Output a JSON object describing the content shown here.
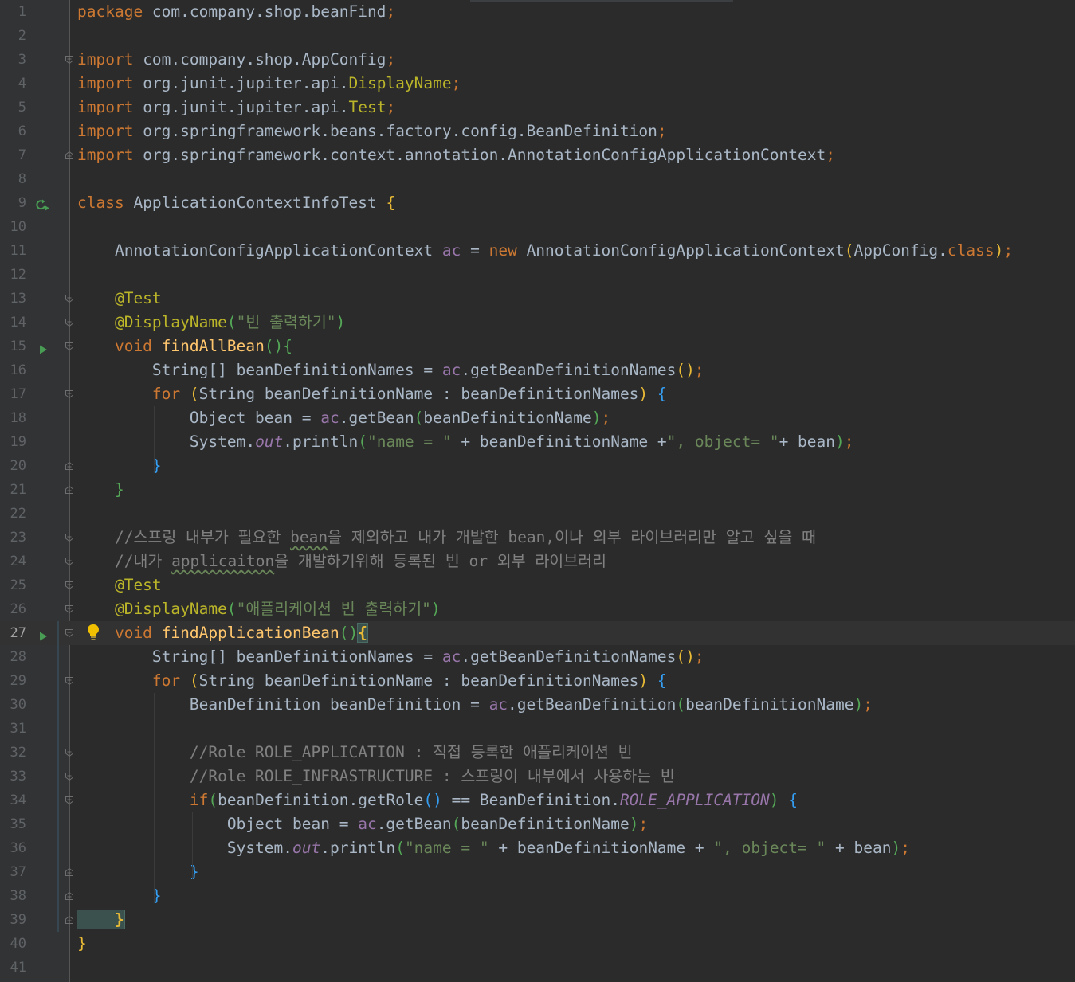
{
  "editor": {
    "current_line": 27,
    "lines": [
      {
        "n": "1",
        "s": [
          [
            "kw",
            "package "
          ],
          [
            "",
            "com.company.shop.beanFind"
          ],
          [
            "kw",
            ";"
          ]
        ]
      },
      {
        "n": "2",
        "s": []
      },
      {
        "n": "3",
        "s": [
          [
            "kw",
            "import "
          ],
          [
            "",
            "com.company.shop.AppConfig"
          ],
          [
            "kw",
            ";"
          ]
        ]
      },
      {
        "n": "4",
        "s": [
          [
            "kw",
            "import "
          ],
          [
            "",
            "org.junit.jupiter.api."
          ],
          [
            "ann",
            "DisplayName"
          ],
          [
            "kw",
            ";"
          ]
        ]
      },
      {
        "n": "5",
        "s": [
          [
            "kw",
            "import "
          ],
          [
            "",
            "org.junit.jupiter.api."
          ],
          [
            "ann",
            "Test"
          ],
          [
            "kw",
            ";"
          ]
        ]
      },
      {
        "n": "6",
        "s": [
          [
            "kw",
            "import "
          ],
          [
            "",
            "org.springframework.beans.factory.config.BeanDefinition"
          ],
          [
            "kw",
            ";"
          ]
        ]
      },
      {
        "n": "7",
        "s": [
          [
            "kw",
            "import "
          ],
          [
            "",
            "org.springframework.context.annotation.AnnotationConfigApplicationContext"
          ],
          [
            "kw",
            ";"
          ]
        ]
      },
      {
        "n": "8",
        "s": []
      },
      {
        "n": "9",
        "s": [
          [
            "kw",
            "class "
          ],
          [
            "",
            "ApplicationContextInfoTest "
          ],
          [
            "pY",
            "{"
          ]
        ]
      },
      {
        "n": "10",
        "s": []
      },
      {
        "n": "11",
        "s": [
          [
            "",
            "    AnnotationConfigApplicationContext "
          ],
          [
            "fld",
            "ac"
          ],
          [
            "",
            " = "
          ],
          [
            "kw",
            "new "
          ],
          [
            "",
            "AnnotationConfigApplicationContext"
          ],
          [
            "pY",
            "("
          ],
          [
            "",
            "AppConfig."
          ],
          [
            "kw",
            "class"
          ],
          [
            "pY",
            ")"
          ],
          [
            "kw",
            ";"
          ]
        ]
      },
      {
        "n": "12",
        "s": []
      },
      {
        "n": "13",
        "s": [
          [
            "ann",
            "    @Test"
          ]
        ]
      },
      {
        "n": "14",
        "s": [
          [
            "ann",
            "    @DisplayName"
          ],
          [
            "pG",
            "("
          ],
          [
            "str",
            "\"빈 출력하기\""
          ],
          [
            "pG",
            ")"
          ]
        ]
      },
      {
        "n": "15",
        "s": [
          [
            "kw",
            "    void "
          ],
          [
            "meth",
            "findAllBean"
          ],
          [
            "pG",
            "()"
          ],
          [
            "pG",
            "{"
          ]
        ]
      },
      {
        "n": "16",
        "s": [
          [
            "",
            "        String[] beanDefinitionNames = "
          ],
          [
            "fld",
            "ac"
          ],
          [
            "",
            "."
          ],
          [
            "",
            "getBeanDefinitionNames"
          ],
          [
            "pY",
            "()"
          ],
          [
            "kw",
            ";"
          ]
        ]
      },
      {
        "n": "17",
        "s": [
          [
            "kw",
            "        for "
          ],
          [
            "pY",
            "("
          ],
          [
            "",
            "String beanDefinitionName : beanDefinitionNames"
          ],
          [
            "pY",
            ")"
          ],
          [
            "",
            " "
          ],
          [
            "pB",
            "{"
          ]
        ]
      },
      {
        "n": "18",
        "s": [
          [
            "",
            "            Object bean = "
          ],
          [
            "fld",
            "ac"
          ],
          [
            "",
            ".getBean"
          ],
          [
            "pG",
            "("
          ],
          [
            "",
            "beanDefinitionName"
          ],
          [
            "pG",
            ")"
          ],
          [
            "kw",
            ";"
          ]
        ]
      },
      {
        "n": "19",
        "s": [
          [
            "",
            "            System."
          ],
          [
            "stat",
            "out"
          ],
          [
            "",
            ".println"
          ],
          [
            "pG",
            "("
          ],
          [
            "str",
            "\"name = \""
          ],
          [
            "",
            " + beanDefinitionName +"
          ],
          [
            "str",
            "\", object= \""
          ],
          [
            "",
            "+ bean"
          ],
          [
            "pG",
            ")"
          ],
          [
            "kw",
            ";"
          ]
        ]
      },
      {
        "n": "20",
        "s": [
          [
            "pB",
            "        }"
          ]
        ]
      },
      {
        "n": "21",
        "s": [
          [
            "pG",
            "    }"
          ]
        ]
      },
      {
        "n": "22",
        "s": []
      },
      {
        "n": "23",
        "s": [
          [
            "cmt",
            "    //스프링 내부가 필요한 "
          ],
          [
            "cmt typo",
            "bean"
          ],
          [
            "cmt",
            "을 제외하고 내가 개발한 bean,이나 외부 라이브러리만 알고 싶을 때"
          ]
        ]
      },
      {
        "n": "24",
        "s": [
          [
            "cmt",
            "    //내가 "
          ],
          [
            "cmt typo",
            "applicaiton"
          ],
          [
            "cmt",
            "을 개발하기위해 등록된 빈 or 외부 라이브러리"
          ]
        ]
      },
      {
        "n": "25",
        "s": [
          [
            "ann",
            "    @Test"
          ]
        ]
      },
      {
        "n": "26",
        "s": [
          [
            "ann",
            "    @DisplayName"
          ],
          [
            "pG",
            "("
          ],
          [
            "str",
            "\"애플리케이션 빈 출력하기\""
          ],
          [
            "pG",
            ")"
          ]
        ]
      },
      {
        "n": "27",
        "s": [
          [
            "kw",
            "    void "
          ],
          [
            "meth",
            "findApplicationBean"
          ],
          [
            "pG",
            "()"
          ],
          [
            "bracket-hl",
            "{"
          ]
        ]
      },
      {
        "n": "28",
        "s": [
          [
            "",
            "        String[] beanDefinitionNames = "
          ],
          [
            "fld",
            "ac"
          ],
          [
            "",
            "."
          ],
          [
            "",
            "getBeanDefinitionNames"
          ],
          [
            "pY",
            "()"
          ],
          [
            "kw",
            ";"
          ]
        ]
      },
      {
        "n": "29",
        "s": [
          [
            "kw",
            "        for "
          ],
          [
            "pY",
            "("
          ],
          [
            "",
            "String beanDefinitionName : beanDefinitionNames"
          ],
          [
            "pY",
            ")"
          ],
          [
            "",
            " "
          ],
          [
            "pB",
            "{"
          ]
        ]
      },
      {
        "n": "30",
        "s": [
          [
            "",
            "            BeanDefinition beanDefinition = "
          ],
          [
            "fld",
            "ac"
          ],
          [
            "",
            ".getBeanDefinition"
          ],
          [
            "pG",
            "("
          ],
          [
            "",
            "beanDefinitionName"
          ],
          [
            "pG",
            ")"
          ],
          [
            "kw",
            ";"
          ]
        ]
      },
      {
        "n": "31",
        "s": []
      },
      {
        "n": "32",
        "s": [
          [
            "cmt",
            "            //Role ROLE_APPLICATION : 직접 등록한 애플리케이션 빈"
          ]
        ]
      },
      {
        "n": "33",
        "s": [
          [
            "cmt",
            "            //Role ROLE_INFRASTRUCTURE : 스프링이 내부에서 사용하는 빈"
          ]
        ]
      },
      {
        "n": "34",
        "s": [
          [
            "kw",
            "            if"
          ],
          [
            "pG",
            "("
          ],
          [
            "",
            "beanDefinition.getRole"
          ],
          [
            "pB",
            "()"
          ],
          [
            "",
            " == BeanDefinition."
          ],
          [
            "stat",
            "ROLE_APPLICATION"
          ],
          [
            "pG",
            ")"
          ],
          [
            "",
            " "
          ],
          [
            "pB",
            "{"
          ]
        ]
      },
      {
        "n": "35",
        "s": [
          [
            "",
            "                Object bean = "
          ],
          [
            "fld",
            "ac"
          ],
          [
            "",
            ".getBean"
          ],
          [
            "pG",
            "("
          ],
          [
            "",
            "beanDefinitionName"
          ],
          [
            "pG",
            ")"
          ],
          [
            "kw",
            ";"
          ]
        ]
      },
      {
        "n": "36",
        "s": [
          [
            "",
            "                System."
          ],
          [
            "stat",
            "out"
          ],
          [
            "",
            ".println"
          ],
          [
            "pG",
            "("
          ],
          [
            "str",
            "\"name = \""
          ],
          [
            "",
            " + beanDefinitionName + "
          ],
          [
            "str",
            "\", object= \""
          ],
          [
            "",
            " + bean"
          ],
          [
            "pG",
            ")"
          ],
          [
            "kw",
            ";"
          ]
        ]
      },
      {
        "n": "37",
        "s": [
          [
            "pB",
            "            }"
          ]
        ]
      },
      {
        "n": "38",
        "s": [
          [
            "pB",
            "        }"
          ]
        ]
      },
      {
        "n": "39",
        "s": [
          [
            "bracket-hl",
            "    }"
          ]
        ]
      },
      {
        "n": "40",
        "s": [
          [
            "pY",
            "}"
          ]
        ]
      },
      {
        "n": "41",
        "s": []
      }
    ],
    "fold_open": [
      3,
      13,
      14,
      15,
      17,
      23,
      24,
      25,
      26,
      27,
      29,
      32,
      33,
      34
    ],
    "fold_close": [
      7,
      20,
      21,
      37,
      38,
      39
    ],
    "run_icons": [
      15,
      27
    ],
    "class_run_icon": 9,
    "bulb_line": 27,
    "colors": {
      "background": "#2b2b2b",
      "gutter": "#313335",
      "keyword": "#cc7832",
      "string": "#6a8759",
      "comment": "#808080",
      "annotation": "#bbb529",
      "method": "#ffc66d",
      "field": "#9876aa",
      "run": "#499c54",
      "bulb": "#f0c000"
    }
  }
}
